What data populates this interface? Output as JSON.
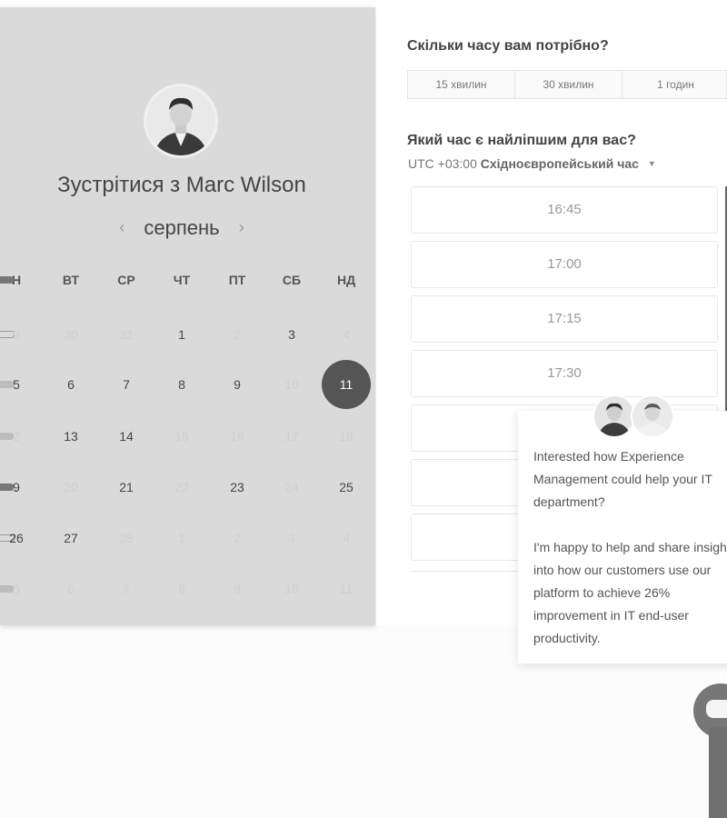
{
  "calendar": {
    "title": "Зустрітися з Marc Wilson",
    "month": "серпень",
    "prev_icon": "‹",
    "next_icon": "›",
    "weekdays": [
      "Н",
      "ВТ",
      "СР",
      "ЧТ",
      "ПТ",
      "СБ",
      "НД"
    ],
    "weeks": [
      [
        "9",
        "30",
        "31",
        "1",
        "2",
        "3",
        "4"
      ],
      [
        "5",
        "6",
        "7",
        "8",
        "9",
        "10",
        "11"
      ],
      [
        "2",
        "13",
        "14",
        "15",
        "16",
        "17",
        "18"
      ],
      [
        "9",
        "20",
        "21",
        "22",
        "23",
        "24",
        "25"
      ],
      [
        "26",
        "27",
        "28",
        "1",
        "2",
        "3",
        "4"
      ],
      [
        "5",
        "6",
        "7",
        "8",
        "9",
        "10",
        "11"
      ]
    ],
    "selected_day": "11"
  },
  "scheduler": {
    "duration_question": "Скільки часу вам потрібно?",
    "durations": [
      "15 хвилин",
      "30 хвилин",
      "1 годин"
    ],
    "time_question": "Який час є найліпшим для вас?",
    "tz_offset": "UTC +03:00",
    "tz_name": "Східноєвропейський час",
    "slots": [
      "16:45",
      "17:00",
      "17:15",
      "17:30",
      "",
      "",
      ""
    ]
  },
  "chat": {
    "message_1": "Interested how Experience Management could help your IT department?",
    "message_2": "I'm happy to help and share insight into how our customers use our platform to achieve 26% improvement in IT end-user productivity."
  },
  "icons": {
    "host_avatar": "avatar-icon",
    "chat_launcher": "chat-bubble-icon",
    "tz_dropdown": "caret-down-icon"
  }
}
